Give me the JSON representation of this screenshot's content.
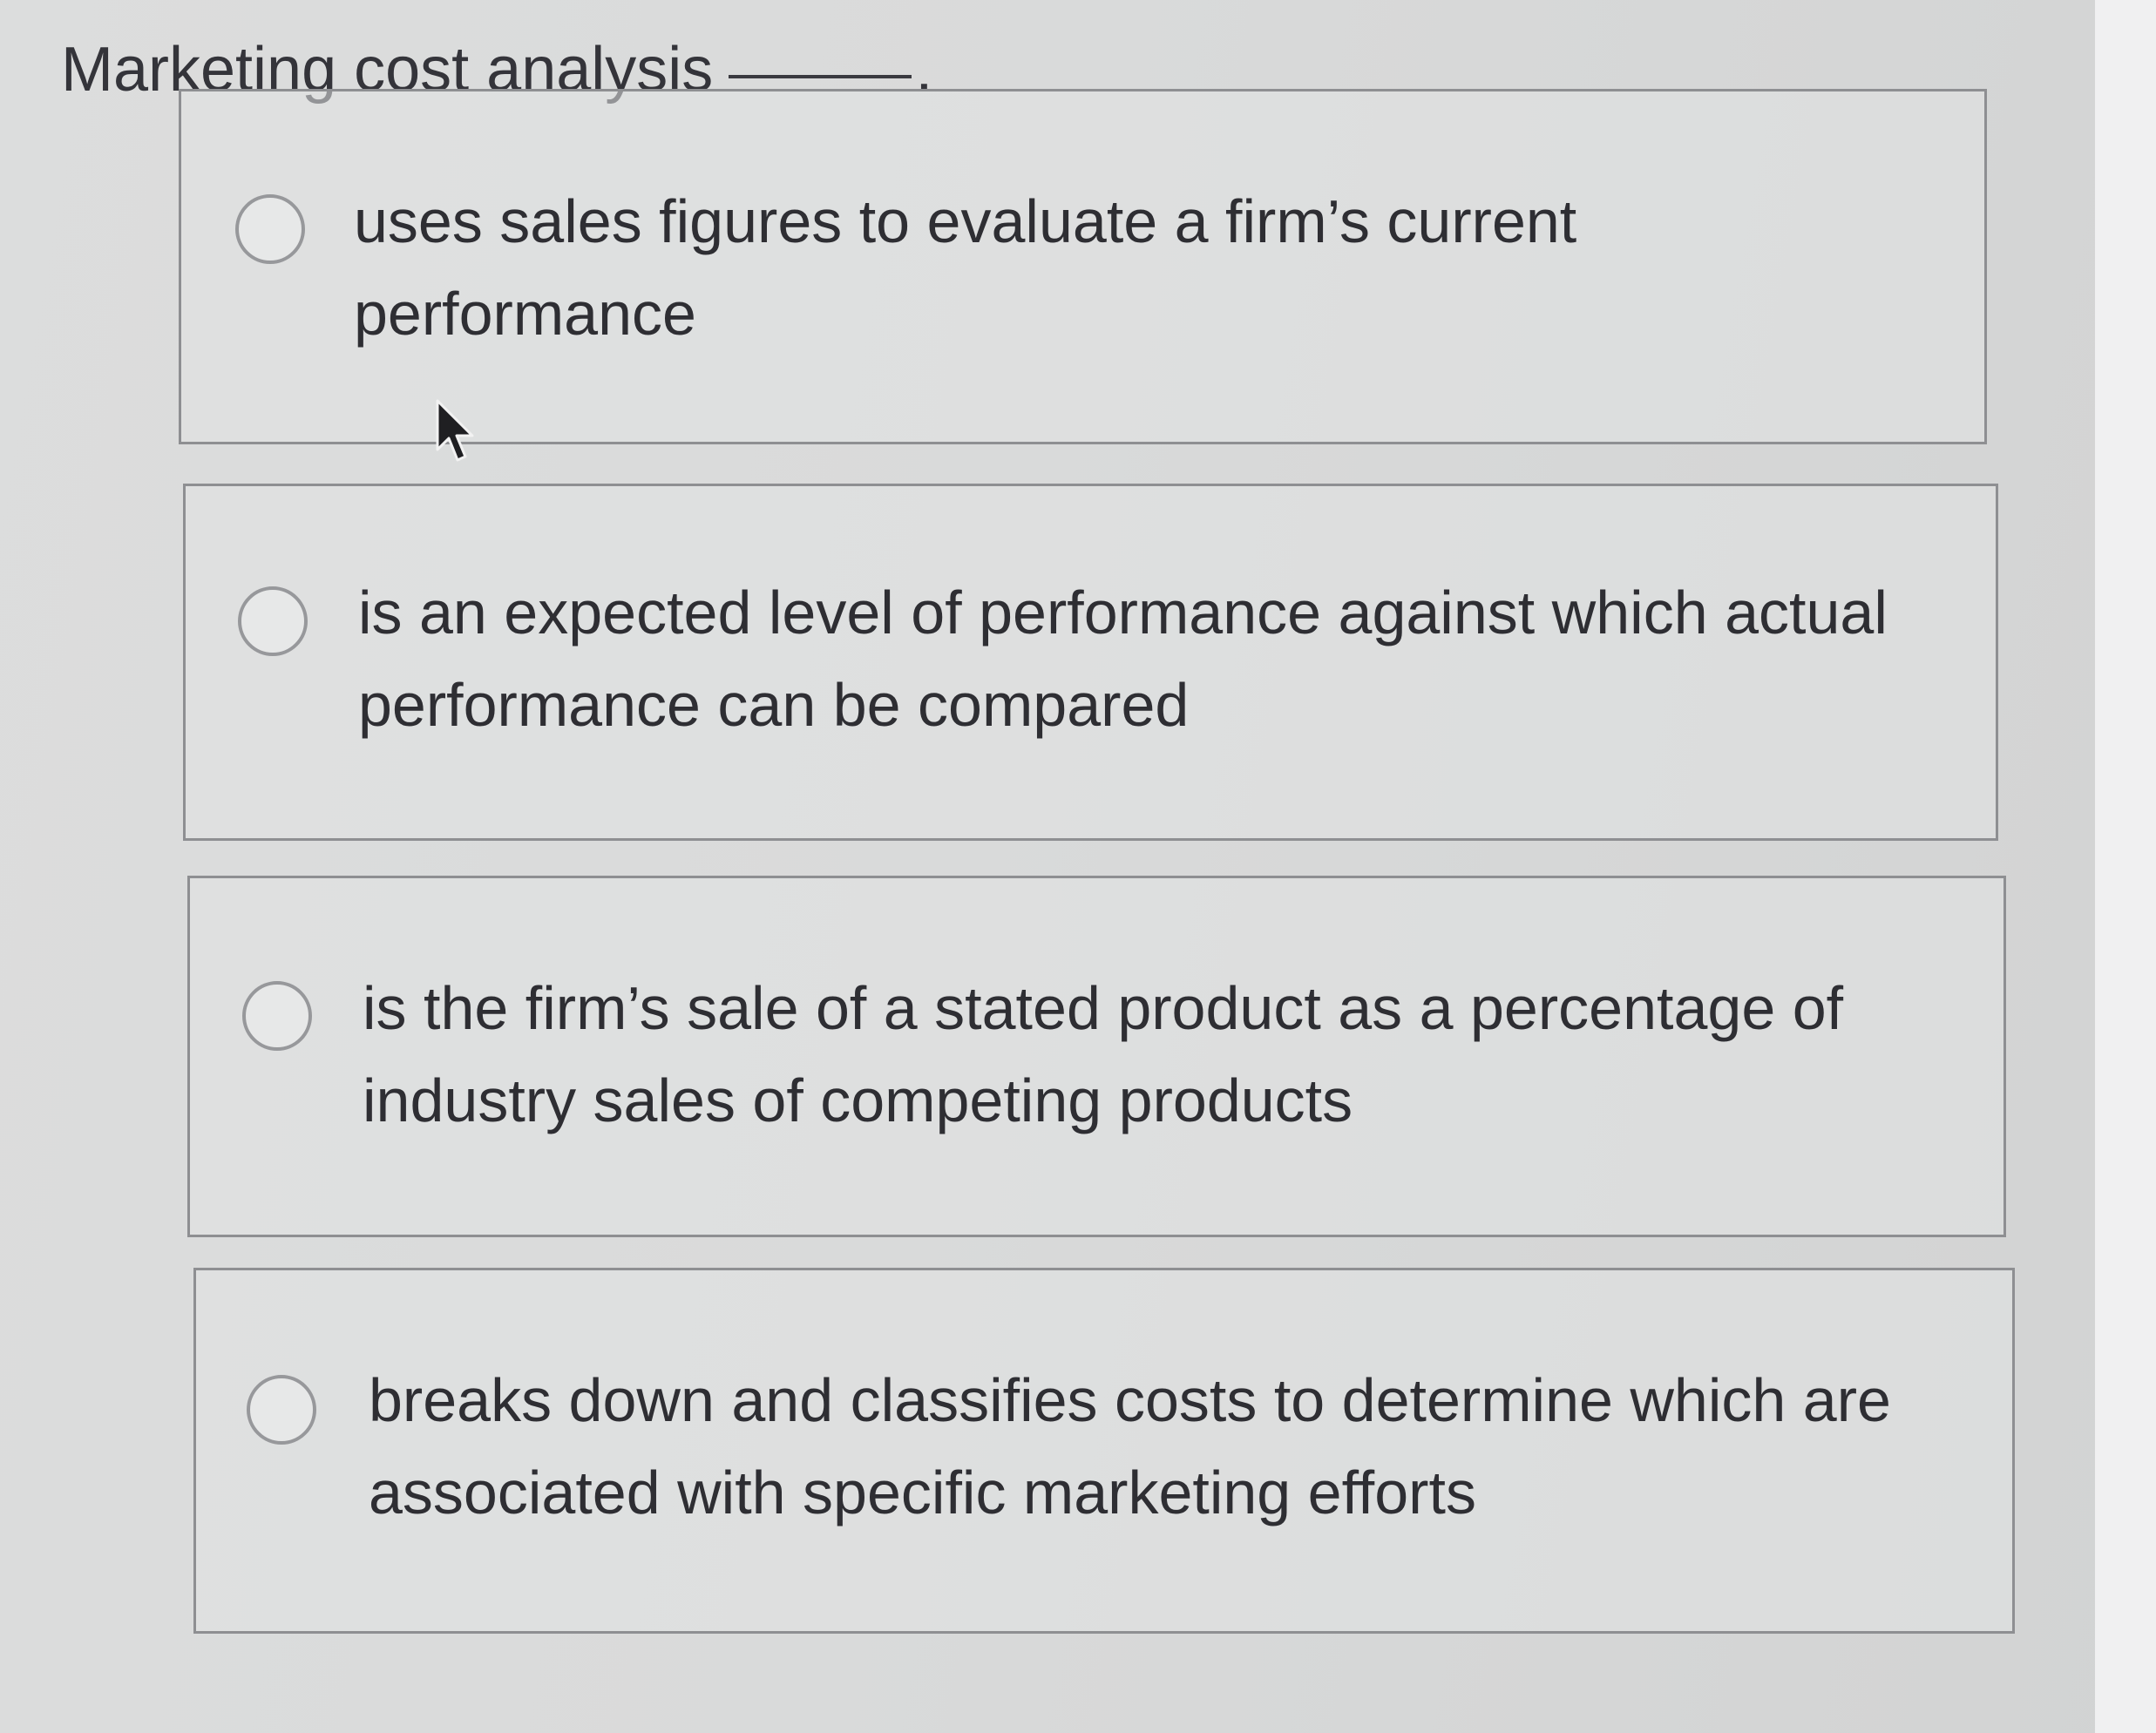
{
  "question": {
    "text": "Marketing cost analysis",
    "period": "."
  },
  "options": [
    {
      "text": "uses sales figures to evaluate a firm’s current performance",
      "selected": false
    },
    {
      "text": "is an expected level of performance against which actual performance can be compared",
      "selected": false
    },
    {
      "text": "is the firm’s sale of a stated product as a percentage of industry sales of competing products",
      "selected": false
    },
    {
      "text": "breaks down and classifies costs to determine which are associated with specific marketing efforts",
      "selected": false
    }
  ],
  "icons": {
    "radio": "radio-unchecked-icon",
    "cursor": "mouse-pointer-icon"
  }
}
